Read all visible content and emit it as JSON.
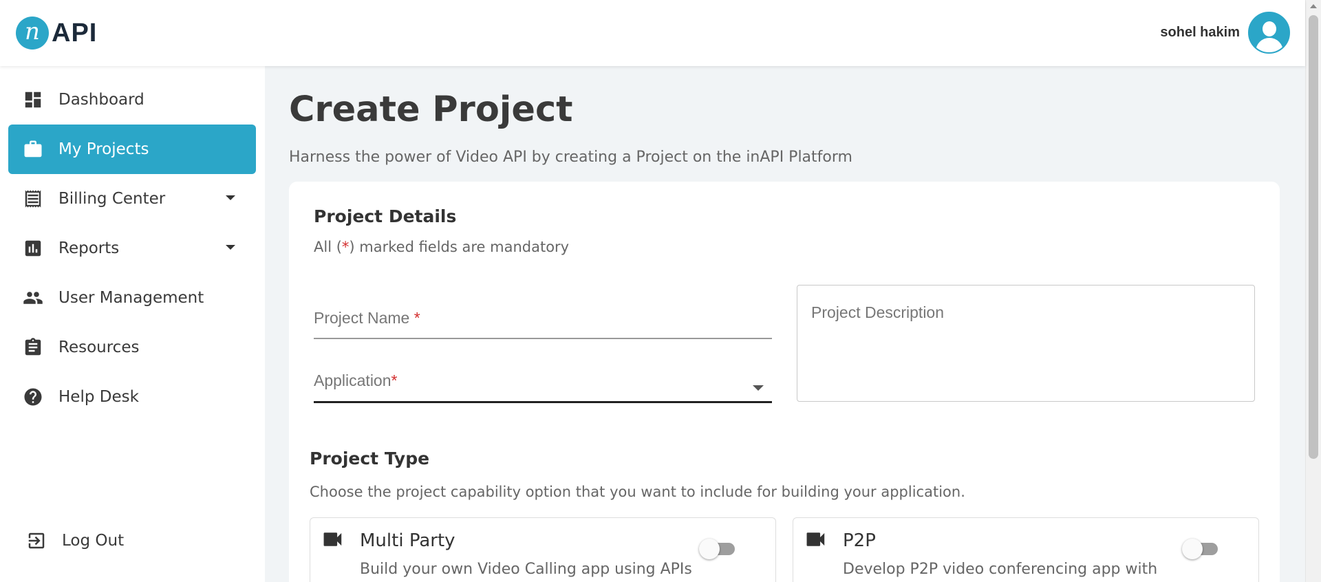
{
  "brand": {
    "logo_letter": "n",
    "logo_text": "API"
  },
  "user": {
    "name": "sohel hakim"
  },
  "sidebar": {
    "items": [
      {
        "label": "Dashboard",
        "icon": "dashboard-icon"
      },
      {
        "label": "My Projects",
        "icon": "briefcase-icon",
        "active": true
      },
      {
        "label": "Billing Center",
        "icon": "receipt-icon",
        "has_submenu": true
      },
      {
        "label": "Reports",
        "icon": "bar-chart-icon",
        "has_submenu": true
      },
      {
        "label": "User Management",
        "icon": "people-icon"
      },
      {
        "label": "Resources",
        "icon": "clipboard-icon"
      },
      {
        "label": "Help Desk",
        "icon": "help-icon"
      }
    ],
    "logout_label": "Log Out"
  },
  "page": {
    "title": "Create Project",
    "subtitle": "Harness the power of Video API by creating a Project on the inAPI Platform"
  },
  "details": {
    "title": "Project Details",
    "note_prefix": "All (",
    "note_star": "*",
    "note_suffix": ") marked fields are mandatory",
    "project_name_label": "Project Name",
    "project_name_required": " *",
    "application_label": "Application",
    "application_required": "*",
    "description_placeholder": "Project Description"
  },
  "project_type": {
    "title": "Project Type",
    "note": "Choose the project capability option that you want to include for building your application.",
    "options": [
      {
        "name": "Multi Party",
        "desc": "Build your own Video Calling app using APIs",
        "enabled": false
      },
      {
        "name": "P2P",
        "desc": "Develop P2P video conferencing app with",
        "enabled": false
      }
    ]
  },
  "colors": {
    "accent": "#2ba6c8",
    "required": "#d32f2f"
  }
}
